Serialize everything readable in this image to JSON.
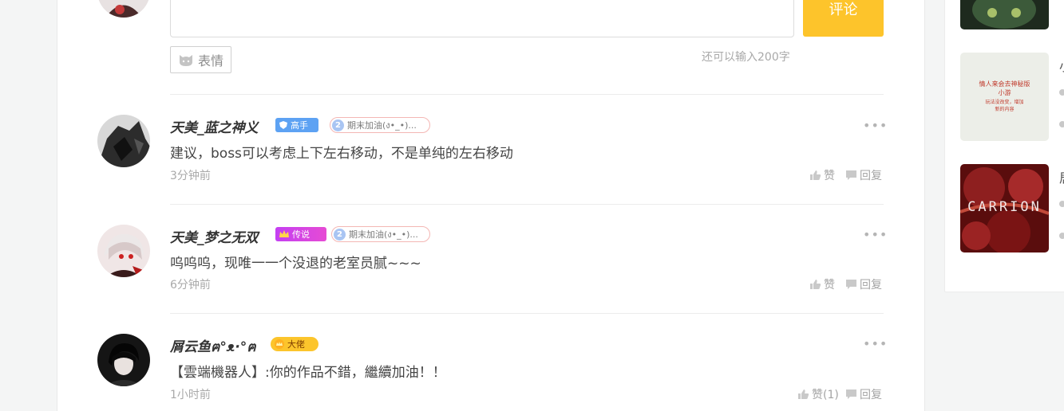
{
  "comment_form": {
    "submit_label": "评论",
    "emoji_label": "表情",
    "char_count_text": "还可以输入200字"
  },
  "comments": [
    {
      "username": "天美_蓝之神义",
      "badge": "高手",
      "medal_num": "2",
      "medal_text": "期末加油(ง•_•)...",
      "text": "建议，boss可以考虑上下左右移动，不是单纯的左右移动",
      "time": "3分钟前",
      "like_label": "赞",
      "reply_label": "回复"
    },
    {
      "username": "天美_梦之无双",
      "badge": "传说",
      "medal_num": "2",
      "medal_text": "期末加油(ง•_•)...",
      "text": "呜呜呜，现唯一一个没退的老室员腻~~~",
      "time": "6分钟前",
      "like_label": "赞",
      "reply_label": "回复"
    },
    {
      "username": "屑云鱼ฅ°ᴥ·°ฅ",
      "badge": "大佬",
      "text": "【雲端機器人】:你的作品不錯，繼續加油！！",
      "time": "1小时前",
      "like_label": "赞(1)",
      "reply_label": "回复"
    }
  ],
  "more_label": "•••",
  "sidebar": {
    "thumb2_lines": [
      "情人来会去神秘版",
      "小游",
      "玩法没改变，增加",
      "新的内容"
    ],
    "thumb3_title": "CARRION",
    "peek_1": "小",
    "peek_2": "居"
  },
  "colors": {
    "accent": "#fdc42b",
    "badge_blue": "#5da2f3",
    "badge_purple": "#c43ff2",
    "badge_yellow": "#fcc52c"
  }
}
